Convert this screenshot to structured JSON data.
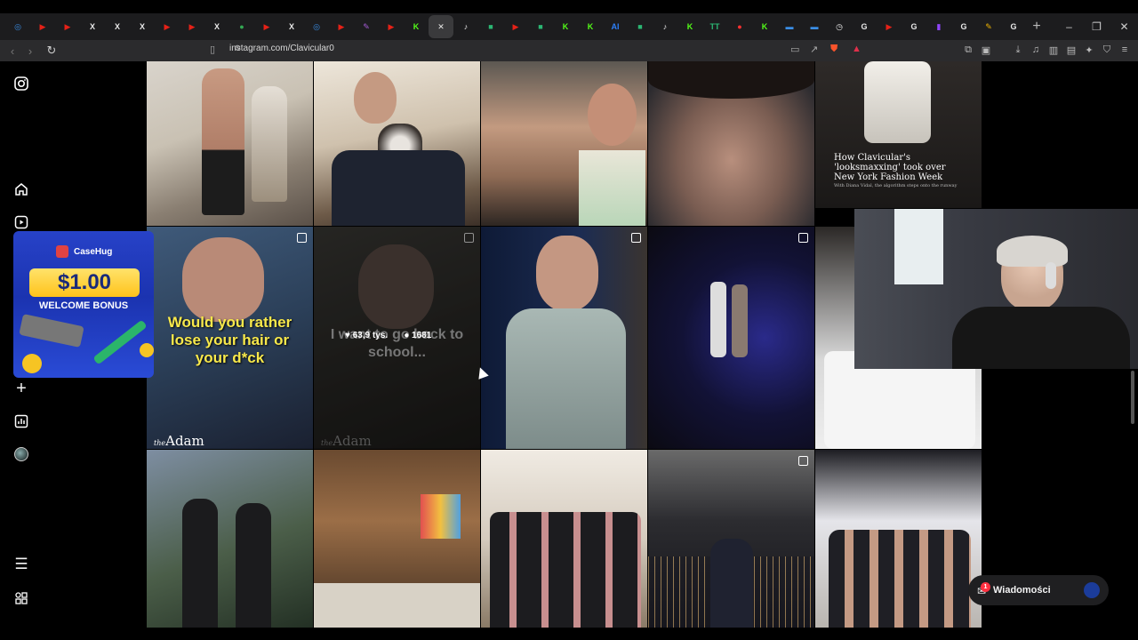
{
  "browser": {
    "url": "instagram.com/Clavicular0",
    "tabs": [
      {
        "icon": "edge-icon",
        "color": "#3a8ee6",
        "glyph": "◎"
      },
      {
        "icon": "youtube-icon",
        "color": "#e62117",
        "glyph": "▶"
      },
      {
        "icon": "youtube-icon",
        "color": "#e62117",
        "glyph": "▶"
      },
      {
        "icon": "x-icon",
        "color": "#e8e8e8",
        "glyph": "X"
      },
      {
        "icon": "x-icon",
        "color": "#e8e8e8",
        "glyph": "X"
      },
      {
        "icon": "x-icon",
        "color": "#e8e8e8",
        "glyph": "X"
      },
      {
        "icon": "youtube-icon",
        "color": "#e62117",
        "glyph": "▶"
      },
      {
        "icon": "youtube-icon",
        "color": "#e62117",
        "glyph": "▶"
      },
      {
        "icon": "x-icon",
        "color": "#e8e8e8",
        "glyph": "X"
      },
      {
        "icon": "maps-icon",
        "color": "#34a853",
        "glyph": "●"
      },
      {
        "icon": "youtube-icon",
        "color": "#e62117",
        "glyph": "▶"
      },
      {
        "icon": "x-icon",
        "color": "#e8e8e8",
        "glyph": "X"
      },
      {
        "icon": "edge-icon",
        "color": "#3a8ee6",
        "glyph": "◎"
      },
      {
        "icon": "youtube-icon",
        "color": "#e62117",
        "glyph": "▶"
      },
      {
        "icon": "pen-icon",
        "color": "#a55cd6",
        "glyph": "✎"
      },
      {
        "icon": "youtube-icon",
        "color": "#e62117",
        "glyph": "▶"
      },
      {
        "icon": "kick-icon",
        "color": "#53fc18",
        "glyph": "K"
      },
      {
        "icon": "close-icon",
        "color": "#e8e8e8",
        "glyph": "✕"
      },
      {
        "icon": "tiktok-icon",
        "color": "#e8e8e8",
        "glyph": "♪"
      },
      {
        "icon": "chat-icon",
        "color": "#2bb673",
        "glyph": "■"
      },
      {
        "icon": "youtube-icon",
        "color": "#e62117",
        "glyph": "▶"
      },
      {
        "icon": "chat-icon",
        "color": "#2bb673",
        "glyph": "■"
      },
      {
        "icon": "kick-icon",
        "color": "#53fc18",
        "glyph": "K"
      },
      {
        "icon": "kick-icon",
        "color": "#53fc18",
        "glyph": "K"
      },
      {
        "icon": "ai-icon",
        "color": "#2d7ff9",
        "glyph": "AI"
      },
      {
        "icon": "chat-icon",
        "color": "#2bb673",
        "glyph": "■"
      },
      {
        "icon": "tiktok-icon",
        "color": "#e8e8e8",
        "glyph": "♪"
      },
      {
        "icon": "kick-icon",
        "color": "#53fc18",
        "glyph": "K"
      },
      {
        "icon": "tt-icon",
        "color": "#2bb673",
        "glyph": "TT"
      },
      {
        "icon": "record-icon",
        "color": "#ff3030",
        "glyph": "●"
      },
      {
        "icon": "kick-icon",
        "color": "#53fc18",
        "glyph": "K"
      },
      {
        "icon": "docs-icon",
        "color": "#3a8ee6",
        "glyph": "▬"
      },
      {
        "icon": "docs-icon",
        "color": "#3a8ee6",
        "glyph": "▬"
      },
      {
        "icon": "clock-icon",
        "color": "#e8e8e8",
        "glyph": "◷"
      },
      {
        "icon": "google-icon",
        "color": "#e8e8e8",
        "glyph": "G"
      },
      {
        "icon": "youtube-icon",
        "color": "#e62117",
        "glyph": "▶"
      },
      {
        "icon": "google-icon",
        "color": "#e8e8e8",
        "glyph": "G"
      },
      {
        "icon": "twitch-icon",
        "color": "#9146ff",
        "glyph": "▮"
      },
      {
        "icon": "google-icon",
        "color": "#e8e8e8",
        "glyph": "G"
      },
      {
        "icon": "pen-icon",
        "color": "#f0b400",
        "glyph": "✎"
      },
      {
        "icon": "google-icon",
        "color": "#e8e8e8",
        "glyph": "G"
      }
    ]
  },
  "posts": {
    "p5_title": "How Clavicular's 'looksmaxxing' took over New York Fashion Week",
    "p5_subtitle": "With Diana Vidal, the algorithm steps onto the runway",
    "p6_caption": "Would you rather lose your hair or your d*ck",
    "p6_brand": "Adam",
    "p6_brand_prefix": "the",
    "p7_caption": "I want to go back to school...",
    "p7_brand": "Adam",
    "p7_brand_prefix": "the",
    "likes": "63,9 tys.",
    "comments": "1681"
  },
  "ad": {
    "brand": "CaseHug",
    "amount": "$1.00",
    "bonus": "WELCOME BONUS"
  },
  "messages": {
    "label": "Wiadomości",
    "unread": "1"
  }
}
